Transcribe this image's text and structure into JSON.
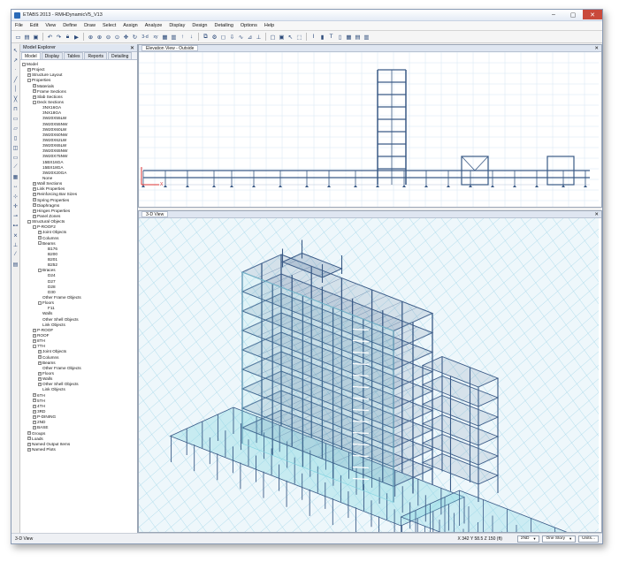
{
  "window": {
    "title": "ETABS 2013 - RMHDynamicV5_V13"
  },
  "menu": [
    "File",
    "Edit",
    "View",
    "Define",
    "Draw",
    "Select",
    "Assign",
    "Analyze",
    "Display",
    "Design",
    "Detailing",
    "Options",
    "Help"
  ],
  "toolbar": {
    "zoom_label": "3-d",
    "xy_label": "xy"
  },
  "explorer": {
    "title": "Model Explorer",
    "tabs": [
      "Model",
      "Display",
      "Tables",
      "Reports",
      "Detailing"
    ],
    "tree": [
      {
        "label": "Model",
        "depth": 0,
        "toggle": "-"
      },
      {
        "label": "Project",
        "depth": 1,
        "toggle": "+"
      },
      {
        "label": "Structure Layout",
        "depth": 1,
        "toggle": "+"
      },
      {
        "label": "Properties",
        "depth": 1,
        "toggle": "-"
      },
      {
        "label": "Materials",
        "depth": 2,
        "toggle": "+"
      },
      {
        "label": "Frame Sections",
        "depth": 2,
        "toggle": "+"
      },
      {
        "label": "Slab Sections",
        "depth": 2,
        "toggle": "+"
      },
      {
        "label": "Deck Sections",
        "depth": 2,
        "toggle": "-"
      },
      {
        "label": "3NX16GA",
        "depth": 3,
        "toggle": ""
      },
      {
        "label": "3NX18GA",
        "depth": 3,
        "toggle": ""
      },
      {
        "label": "3W20X55LW",
        "depth": 3,
        "toggle": ""
      },
      {
        "label": "3W20X55NW",
        "depth": 3,
        "toggle": ""
      },
      {
        "label": "3W20X60LW",
        "depth": 3,
        "toggle": ""
      },
      {
        "label": "3W20X60NW",
        "depth": 3,
        "toggle": ""
      },
      {
        "label": "3W20X62LW",
        "depth": 3,
        "toggle": ""
      },
      {
        "label": "3W20X65LW",
        "depth": 3,
        "toggle": ""
      },
      {
        "label": "3W20X65NW",
        "depth": 3,
        "toggle": ""
      },
      {
        "label": "3W20X75NW",
        "depth": 3,
        "toggle": ""
      },
      {
        "label": "15BX16GA",
        "depth": 3,
        "toggle": ""
      },
      {
        "label": "15BX18GA",
        "depth": 3,
        "toggle": ""
      },
      {
        "label": "3W20X20GA",
        "depth": 3,
        "toggle": ""
      },
      {
        "label": "None",
        "depth": 3,
        "toggle": ""
      },
      {
        "label": "Wall Sections",
        "depth": 2,
        "toggle": "+"
      },
      {
        "label": "Link Properties",
        "depth": 2,
        "toggle": "+"
      },
      {
        "label": "Reinforcing Bar Sizes",
        "depth": 2,
        "toggle": "+"
      },
      {
        "label": "Spring Properties",
        "depth": 2,
        "toggle": "+"
      },
      {
        "label": "Diaphragms",
        "depth": 2,
        "toggle": "+"
      },
      {
        "label": "Hinges Properties",
        "depth": 2,
        "toggle": "+"
      },
      {
        "label": "Panel Zones",
        "depth": 2,
        "toggle": "+"
      },
      {
        "label": "Structural Objects",
        "depth": 1,
        "toggle": "-"
      },
      {
        "label": "P-ROOF2",
        "depth": 2,
        "toggle": "-"
      },
      {
        "label": "Joint Objects",
        "depth": 3,
        "toggle": "+"
      },
      {
        "label": "Columns",
        "depth": 3,
        "toggle": "+"
      },
      {
        "label": "Beams",
        "depth": 3,
        "toggle": "-"
      },
      {
        "label": "B176",
        "depth": 4,
        "toggle": ""
      },
      {
        "label": "B200",
        "depth": 4,
        "toggle": ""
      },
      {
        "label": "B201",
        "depth": 4,
        "toggle": ""
      },
      {
        "label": "B252",
        "depth": 4,
        "toggle": ""
      },
      {
        "label": "Braces",
        "depth": 3,
        "toggle": "-"
      },
      {
        "label": "D24",
        "depth": 4,
        "toggle": ""
      },
      {
        "label": "D27",
        "depth": 4,
        "toggle": ""
      },
      {
        "label": "D28",
        "depth": 4,
        "toggle": ""
      },
      {
        "label": "D30",
        "depth": 4,
        "toggle": ""
      },
      {
        "label": "Other Frame Objects",
        "depth": 3,
        "toggle": ""
      },
      {
        "label": "Floors",
        "depth": 3,
        "toggle": "-"
      },
      {
        "label": "F11",
        "depth": 4,
        "toggle": ""
      },
      {
        "label": "Walls",
        "depth": 3,
        "toggle": ""
      },
      {
        "label": "Other Shell Objects",
        "depth": 3,
        "toggle": ""
      },
      {
        "label": "Link Objects",
        "depth": 3,
        "toggle": ""
      },
      {
        "label": "P-ROOF",
        "depth": 2,
        "toggle": "+"
      },
      {
        "label": "ROOF",
        "depth": 2,
        "toggle": "+"
      },
      {
        "label": "8TH",
        "depth": 2,
        "toggle": "+"
      },
      {
        "label": "7TH",
        "depth": 2,
        "toggle": "-"
      },
      {
        "label": "Joint Objects",
        "depth": 3,
        "toggle": "+"
      },
      {
        "label": "Columns",
        "depth": 3,
        "toggle": "+"
      },
      {
        "label": "Beams",
        "depth": 3,
        "toggle": "+"
      },
      {
        "label": "Other Frame Objects",
        "depth": 3,
        "toggle": ""
      },
      {
        "label": "Floors",
        "depth": 3,
        "toggle": "+"
      },
      {
        "label": "Walls",
        "depth": 3,
        "toggle": "+"
      },
      {
        "label": "Other Shell Objects",
        "depth": 3,
        "toggle": "+"
      },
      {
        "label": "Link Objects",
        "depth": 3,
        "toggle": ""
      },
      {
        "label": "6TH",
        "depth": 2,
        "toggle": "+"
      },
      {
        "label": "5TH",
        "depth": 2,
        "toggle": "+"
      },
      {
        "label": "4TH",
        "depth": 2,
        "toggle": "+"
      },
      {
        "label": "3RD",
        "depth": 2,
        "toggle": "+"
      },
      {
        "label": "P-DINING",
        "depth": 2,
        "toggle": "+"
      },
      {
        "label": "2ND",
        "depth": 2,
        "toggle": "+"
      },
      {
        "label": "BASE",
        "depth": 2,
        "toggle": "+"
      },
      {
        "label": "Groups",
        "depth": 1,
        "toggle": "+"
      },
      {
        "label": "Loads",
        "depth": 1,
        "toggle": "+"
      },
      {
        "label": "Named Output Items",
        "depth": 1,
        "toggle": "+"
      },
      {
        "label": "Named Plots",
        "depth": 1,
        "toggle": "+"
      }
    ]
  },
  "elevation_view": {
    "title": "Elevation View - Outside",
    "axis_label": "X"
  },
  "view3d": {
    "title": "3-D View"
  },
  "status": {
    "left": "3-D View",
    "coords": "X 342  Y 58.5  Z 150 (ft)",
    "story": "2ND",
    "story_mode": "One Story",
    "units": "Units..."
  },
  "colors": {
    "frame": "#3a5a86",
    "slab": "#7fd3e0",
    "grid": "#a8d9ea",
    "accent": "#2a6ab8"
  }
}
